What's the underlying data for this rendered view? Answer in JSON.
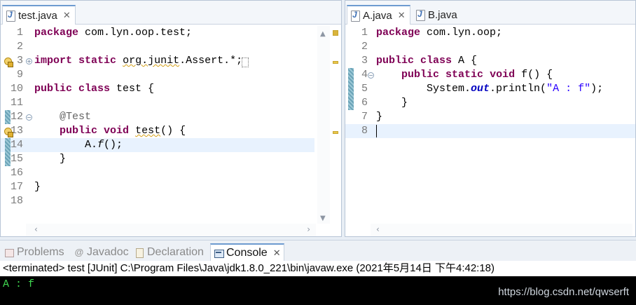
{
  "left_editor": {
    "tabs": [
      {
        "label": "test.java",
        "close": "✕",
        "active": true
      }
    ],
    "lines": [
      {
        "num": "1",
        "html": "<span class=\"kw\">package</span> com.lyn.oop.test;"
      },
      {
        "num": "2",
        "html": ""
      },
      {
        "num": "3",
        "html": "<span class=\"kw\">import</span> <span class=\"kw\">static</span> <span class=\"squig\">org.junit</span>.Assert.*;"
      },
      {
        "num": "9",
        "html": ""
      },
      {
        "num": "10",
        "html": "<span class=\"kw\">public</span> <span class=\"kw\">class</span> test {"
      },
      {
        "num": "11",
        "html": ""
      },
      {
        "num": "12",
        "html": "    <span class=\"ann\">@Test</span>"
      },
      {
        "num": "13",
        "html": "    <span class=\"kw\">public</span> <span class=\"kw\">void</span> <span class=\"squig\">test</span>() {"
      },
      {
        "num": "14",
        "html": "        A.<span class=\"ital\">f</span>();"
      },
      {
        "num": "15",
        "html": "    }"
      },
      {
        "num": "16",
        "html": ""
      },
      {
        "num": "17",
        "html": "}"
      },
      {
        "num": "18",
        "html": ""
      }
    ]
  },
  "right_editor": {
    "tabs": [
      {
        "label": "A.java",
        "close": "✕",
        "active": true
      },
      {
        "label": "B.java",
        "close": "",
        "active": false
      }
    ],
    "lines": [
      {
        "num": "1",
        "html": "<span class=\"kw\">package</span> com.lyn.oop;"
      },
      {
        "num": "2",
        "html": ""
      },
      {
        "num": "3",
        "html": "<span class=\"kw\">public</span> <span class=\"kw\">class</span> A {"
      },
      {
        "num": "4",
        "html": "    <span class=\"kw\">public</span> <span class=\"kw\">static</span> <span class=\"kw\">void</span> f() {"
      },
      {
        "num": "5",
        "html": "        System.<span class=\"field\">out</span>.println(<span class=\"str\">\"A : f\"</span>);"
      },
      {
        "num": "6",
        "html": "    }"
      },
      {
        "num": "7",
        "html": "}"
      },
      {
        "num": "8",
        "html": ""
      }
    ]
  },
  "views": {
    "tabs": [
      {
        "label": "Problems",
        "icon": "problems-icon"
      },
      {
        "label": "Javadoc",
        "icon": "javadoc-icon",
        "glyph": "@"
      },
      {
        "label": "Declaration",
        "icon": "declaration-icon"
      },
      {
        "label": "Console",
        "icon": "console-icon",
        "close": "✕"
      }
    ]
  },
  "console": {
    "status": "<terminated> test [JUnit] C:\\Program Files\\Java\\jdk1.8.0_221\\bin\\javaw.exe (2021年5月14日 下午4:42:18)",
    "output": "A : f",
    "watermark": "https://blog.csdn.net/qwserft"
  }
}
